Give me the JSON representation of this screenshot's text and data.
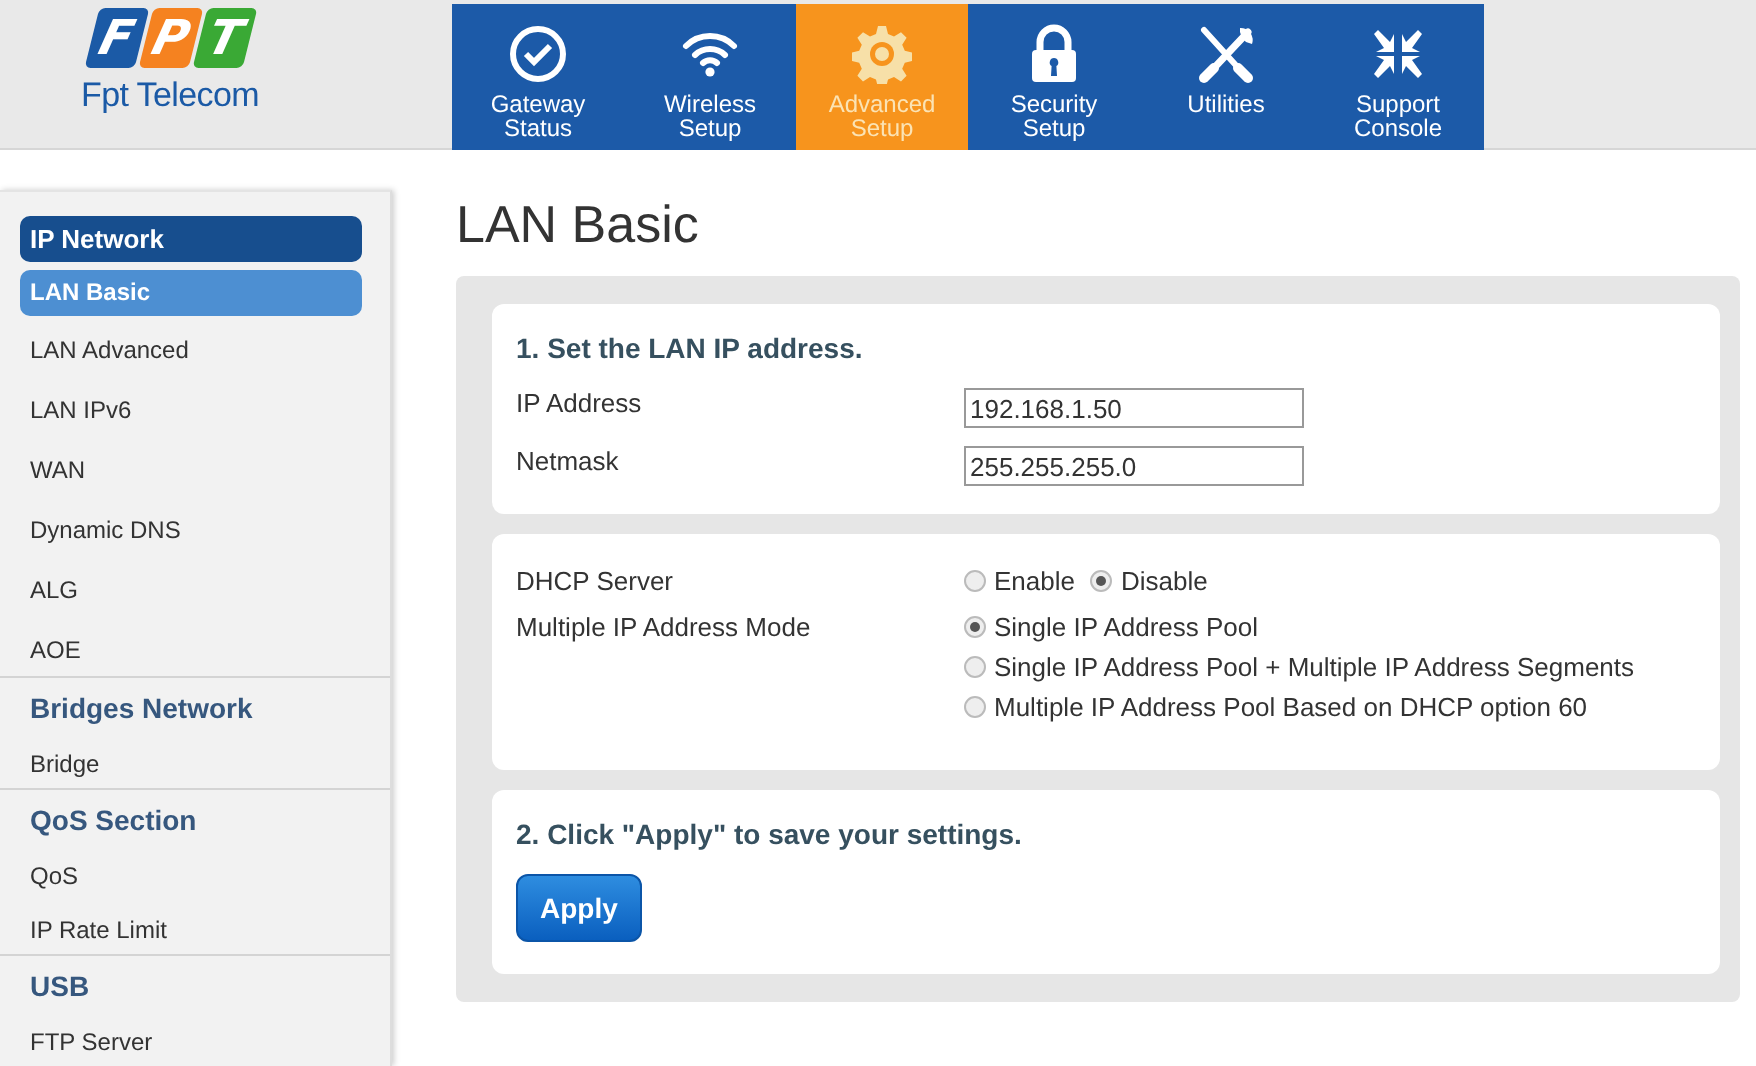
{
  "logo": {
    "letters": [
      "F",
      "P",
      "T"
    ],
    "name": "Fpt Telecom"
  },
  "nav": [
    {
      "label": "Gateway Status",
      "selected": false
    },
    {
      "label": "Wireless Setup",
      "selected": false
    },
    {
      "label": "Advanced Setup",
      "selected": true
    },
    {
      "label": "Security Setup",
      "selected": false
    },
    {
      "label": "Utilities",
      "selected": false
    },
    {
      "label": "Support Console",
      "selected": false
    }
  ],
  "sidebar": [
    {
      "heading": "IP Network",
      "active": true,
      "items": [
        {
          "label": "LAN Basic",
          "selected": true
        },
        {
          "label": "LAN Advanced",
          "selected": false
        },
        {
          "label": "LAN IPv6",
          "selected": false
        },
        {
          "label": "WAN",
          "selected": false
        },
        {
          "label": "Dynamic DNS",
          "selected": false
        },
        {
          "label": "ALG",
          "selected": false
        },
        {
          "label": "AOE",
          "selected": false
        }
      ]
    },
    {
      "heading": "Bridges Network",
      "active": false,
      "items": [
        {
          "label": "Bridge",
          "selected": false
        }
      ]
    },
    {
      "heading": "QoS Section",
      "active": false,
      "items": [
        {
          "label": "QoS",
          "selected": false
        },
        {
          "label": "IP Rate Limit",
          "selected": false
        }
      ]
    },
    {
      "heading": "USB",
      "active": false,
      "items": [
        {
          "label": "FTP Server",
          "selected": false
        }
      ]
    }
  ],
  "page_title": "LAN Basic",
  "lan_section": {
    "heading": "1. Set the LAN IP address.",
    "fields": [
      {
        "label": "IP Address",
        "value": "192.168.1.50"
      },
      {
        "label": "Netmask",
        "value": "255.255.255.0"
      }
    ]
  },
  "dhcp_section": {
    "groups": [
      {
        "label": "DHCP Server",
        "inline": true,
        "options": [
          {
            "label": "Enable",
            "selected": false
          },
          {
            "label": "Disable",
            "selected": true
          }
        ]
      },
      {
        "label": "Multiple IP Address Mode",
        "inline": false,
        "options": [
          {
            "label": "Single IP Address Pool",
            "selected": true
          },
          {
            "label": "Single IP Address Pool + Multiple IP Address Segments",
            "selected": false
          },
          {
            "label": "Multiple IP Address Pool Based on DHCP option 60",
            "selected": false
          }
        ]
      }
    ]
  },
  "apply_section": {
    "heading": "2. Click \"Apply\" to save your settings.",
    "button": "Apply"
  }
}
